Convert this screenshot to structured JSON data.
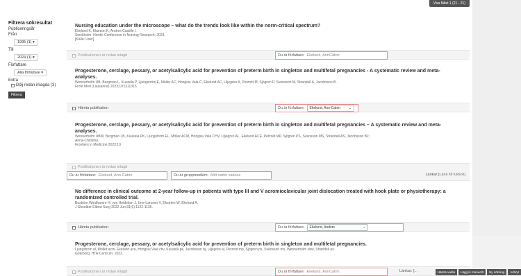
{
  "top_button": "Visa fältet 1 (21 - 21)",
  "sidebar": {
    "title": "Filtrera sökresultat",
    "pub_year_label": "Publiceringsår",
    "from_label": "Från",
    "from_value": "1995 (1) ▾",
    "to_label": "Till",
    "to_value": "2024 (1) ▾",
    "author_label": "Författare",
    "author_value": "Alla författare  ▾",
    "extra_label": "Extra",
    "hide_label": "Dölj redan inlagda (3)",
    "filter_button": "Filtrera"
  },
  "entries": [
    {
      "title": "Nursing education under the microscope – what do the trends look like within the norm-critical spectrum?",
      "authors": "Ekelund K, Klaeson K, Andres Castillo I.",
      "source": "Stockholm: Nordic Conference in Nursing Research; 2024.",
      "extra": "[Källa: User]",
      "bar_left": "Publikationen är redan inlagd",
      "author_field_label": "Du är författare:",
      "author_field_value": "Ekelund, AnnCatrin"
    },
    {
      "title": "Progesterone, cerclage, pessary, or acetylsalicylic acid for prevention of preterm birth in singleton and multifetal pregnancies - A systematic review and meta-analyses.",
      "authors": "Wennerholm UB, Bergman L, Kuusela P, Ljungström E, Möller AC, Hongsiu Vala C, Ekelund AC, Liljegren A, Petzold M, Sjögren P, Svensson M, Strandell A, Jacobsson B.",
      "source": "Front Med (Lausanne) 2023;10:1111315.",
      "bar_left": "Hämta publikation",
      "author_field_label": "Du är författare:",
      "author_field_value": "Ekelund, Ann-Catrin"
    },
    {
      "title": "Progesterone, cerclage, pessary, or acetylsalicylic acid for prevention of preterm birth in singleton and multifetal pregnancies – A systematic review and meta-analyses.",
      "authors": "Wennerholm UBW, Bergman LB, Kuusela PK, Ljungström EL, Möller ACM, Hongsiu Vala CHV, Liljegren AL, Ekelund ACE, Petzold MP, Sjögren PS, Svensson MS, Strandell AS, Jacobsson BJ;",
      "authors2": "Anna-Christina.",
      "source": "Frontiers in Medicine 2023:10",
      "bar_left": "Publikationen är redan inlagd",
      "author_field_label": "Du är författare:",
      "author_field_value": "Ekelund, Ann-Catrin",
      "group_field_label": "Du är gruppmedlem:",
      "group_field_value": "Mitt namn saknas",
      "links_label": "Länkar:",
      "links_value": "[Länk till fulltext]"
    },
    {
      "title": "No difference in clinical outcome at 2-year follow-up in patients with type III and V acromioclavicular joint dislocation treated with hook plate or physiotherapy: a randomized controlled trial.",
      "authors": "Boström Windhamre H, von Heideken J, Une-Larsson V, Ekström W, Ekelund A.",
      "source": "J Shoulder Elbow Surg 2022 Jun;31(6):1122-1136.",
      "bar_left": "Hämta publikation",
      "author_field_label": "Du är författare:",
      "author_field_value": "Ekelund, Anders"
    },
    {
      "title": "Progesterone, cerclage, pessary, or acetylsalicylic acid for prevention of preterm birth in singleton and multifetal pregnancies.",
      "authors": "Ljungström el, Möller acm, Ekelund ace, Hongsiu Vala chv, Kuusela pk, Jacobsson bj, Liljegren al, Petzold mp, Sjögren ps, Svensson ms, Wennerholm ubw, Strandell as.",
      "source": "Göteborg: HTA-Centrum; 2022.",
      "bar_left": "Publikationen är redan inlagd",
      "author_field_label": "Du är författare:",
      "author_field_value": "Ekelund, AnnCatrin",
      "links_label": "Länkar: [..."
    }
  ],
  "bottom_buttons": [
    "Hämta valda",
    "Lägg in manuellt",
    "Ny sökning",
    "Avbryt"
  ]
}
